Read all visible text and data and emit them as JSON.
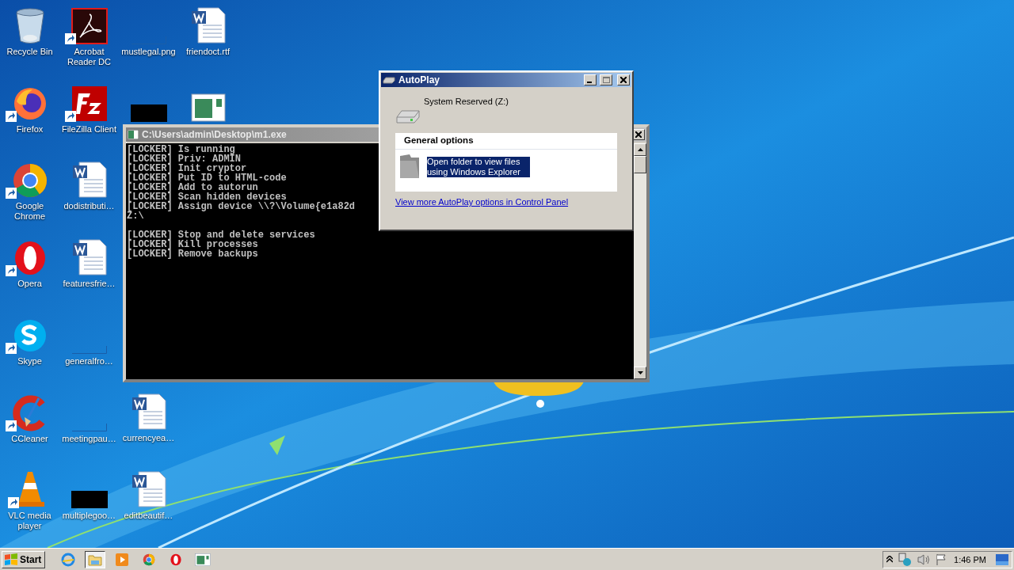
{
  "desktop": {
    "columns": [
      {
        "items": [
          {
            "kind": "recycle",
            "label": "Recycle Bin"
          },
          {
            "kind": "firefox",
            "label": "Firefox",
            "shortcut": true
          },
          {
            "kind": "chrome",
            "label": "Google Chrome",
            "shortcut": true
          },
          {
            "kind": "opera",
            "label": "Opera",
            "shortcut": true
          },
          {
            "kind": "skype",
            "label": "Skype",
            "shortcut": true
          },
          {
            "kind": "ccleaner",
            "label": "CCleaner",
            "shortcut": true
          },
          {
            "kind": "vlc",
            "label": "VLC media player",
            "shortcut": true
          }
        ]
      },
      {
        "items": [
          {
            "kind": "acrobat",
            "label": "Acrobat Reader DC",
            "shortcut": true
          },
          {
            "kind": "filezilla",
            "label": "FileZilla Client",
            "shortcut": true
          },
          {
            "kind": "word",
            "label": "dodistributi…"
          },
          {
            "kind": "word",
            "label": "featuresfrie…"
          },
          {
            "kind": "blank",
            "label": "generalfro…"
          },
          {
            "kind": "blank",
            "label": "meetingpau…"
          },
          {
            "kind": "dark",
            "label": "multiplegoo…"
          }
        ]
      },
      {
        "items": [
          {
            "kind": "blank",
            "label": "mustlegal.png"
          },
          {
            "kind": "dark"
          }
        ],
        "bottom_items": [
          {
            "kind": "word",
            "label": "currencyea…"
          },
          {
            "kind": "word",
            "label": "editbeautif…"
          }
        ]
      },
      {
        "items": [
          {
            "kind": "word",
            "label": "friendoct.rtf"
          },
          {
            "kind": "window"
          }
        ]
      }
    ]
  },
  "console": {
    "title": "C:\\Users\\admin\\Desktop\\m1.exe",
    "blocks": [
      {
        "lines": [
          "[LOCKER] Is running",
          "[LOCKER] Priv: ADMIN",
          "[LOCKER] Init cryptor",
          "[LOCKER] Put ID to HTML-code",
          "[LOCKER] Add to autorun",
          "[LOCKER] Scan hidden devices",
          "[LOCKER] Assign device \\\\?\\Volume{e1a82d",
          "Z:\\"
        ]
      },
      {
        "lines": [
          "[LOCKER] Stop and delete services",
          "[LOCKER] Kill processes",
          "[LOCKER] Remove backups"
        ]
      }
    ]
  },
  "autoplay": {
    "title": "AutoPlay",
    "drive": "System Reserved (Z:)",
    "section": "General options",
    "options": [
      {
        "text": "Open folder to view files using Windows Explorer",
        "selected": true
      }
    ],
    "link": "View more AutoPlay options in Control Panel"
  },
  "taskbar": {
    "start": "Start",
    "apps": [
      {
        "kind": "ie",
        "selected": false
      },
      {
        "kind": "explorer",
        "selected": true
      },
      {
        "kind": "media",
        "selected": false
      },
      {
        "kind": "chrome",
        "selected": false
      },
      {
        "kind": "opera",
        "selected": false
      },
      {
        "kind": "window",
        "selected": false
      }
    ],
    "clock": "1:46 PM"
  }
}
